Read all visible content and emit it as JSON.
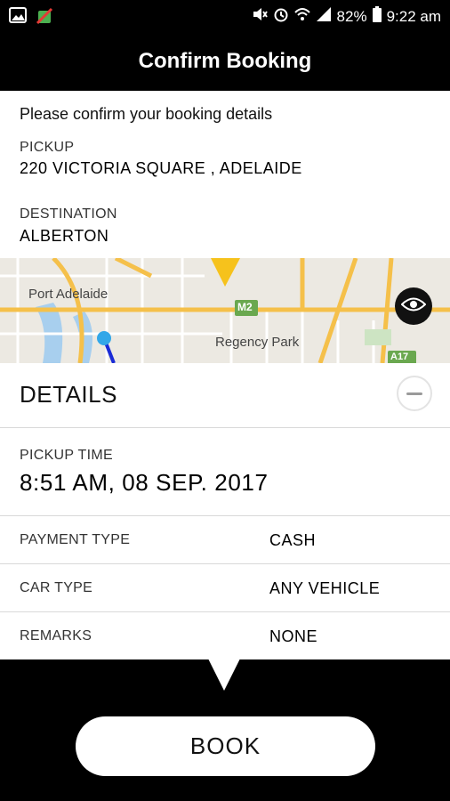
{
  "status_bar": {
    "icons": [
      "image-icon",
      "no-sim-icon",
      "mute-icon",
      "alarm-icon",
      "wifi-icon",
      "signal-icon",
      "battery-icon"
    ],
    "battery": "82%",
    "time": "9:22 am"
  },
  "appbar": {
    "title": "Confirm Booking"
  },
  "booking": {
    "intro": "Please confirm your booking details",
    "pickup_label": "PICKUP",
    "pickup_value": "220 VICTORIA SQUARE , ADELAIDE",
    "destination_label": "DESTINATION",
    "destination_value": "ALBERTON"
  },
  "map": {
    "labels": {
      "port_adelaide": "Port Adelaide",
      "regency_park": "Regency Park",
      "m2": "M2",
      "a17": "A17"
    },
    "colors": {
      "road": "#f5c04a",
      "route": "#1a2bd6",
      "marker": "#f6c21c",
      "pin": "#33a7e8"
    }
  },
  "details": {
    "title": "DETAILS",
    "pickup_time_label": "PICKUP TIME",
    "pickup_time_value": "8:51 AM, 08 SEP. 2017",
    "rows": [
      {
        "label": "PAYMENT TYPE",
        "value": "CASH"
      },
      {
        "label": "CAR TYPE",
        "value": "ANY VEHICLE"
      },
      {
        "label": "REMARKS",
        "value": "NONE"
      }
    ]
  },
  "footer": {
    "book_label": "BOOK"
  },
  "colors": {
    "bar_bg": "#000000",
    "content_bg": "#ffffff",
    "divider": "#d9d9d9"
  }
}
